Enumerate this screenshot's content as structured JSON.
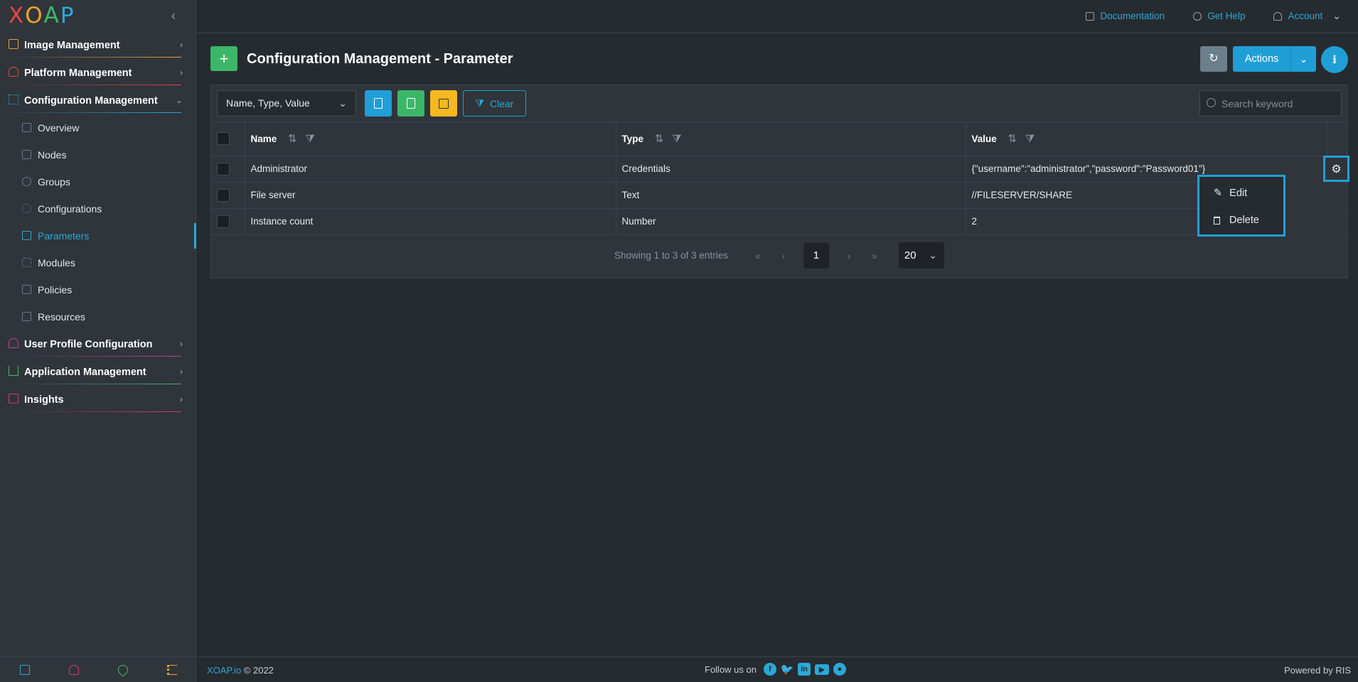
{
  "app": {
    "logo": [
      "X",
      "O",
      "A",
      "P"
    ],
    "logo_colors": [
      "#e8453c",
      "#f0a030",
      "#40b868",
      "#2aa8d8"
    ]
  },
  "topbar": {
    "documentation": "Documentation",
    "get_help": "Get Help",
    "account": "Account"
  },
  "sidebar": {
    "groups": [
      {
        "label": "Image Management",
        "color": "#f0a030",
        "icon": "image-icon"
      },
      {
        "label": "Platform Management",
        "color": "#e8453c",
        "icon": "cloud-icon"
      },
      {
        "label": "Configuration Management",
        "color": "#2aa8d8",
        "icon": "config-icon"
      }
    ],
    "items": [
      {
        "label": "Overview"
      },
      {
        "label": "Nodes"
      },
      {
        "label": "Groups"
      },
      {
        "label": "Configurations"
      },
      {
        "label": "Parameters"
      },
      {
        "label": "Modules"
      },
      {
        "label": "Policies"
      },
      {
        "label": "Resources"
      }
    ],
    "groups2": [
      {
        "label": "User Profile Configuration",
        "color": "#c2409a",
        "icon": "user-profile-icon"
      },
      {
        "label": "Application Management",
        "color": "#40b868",
        "icon": "sitemap-icon"
      },
      {
        "label": "Insights",
        "color": "#d63a6a",
        "icon": "monitor-icon"
      }
    ]
  },
  "header": {
    "add": "+",
    "title": "Configuration Management - Parameter",
    "actions": "Actions",
    "info": "i"
  },
  "toolbar": {
    "columns": "Name, Type, Value",
    "clear": "Clear",
    "search_placeholder": "Search keyword"
  },
  "table": {
    "headers": [
      "Name",
      "Type",
      "Value"
    ],
    "rows": [
      {
        "name": "Administrator",
        "type": "Credentials",
        "value": "{\"username\":\"administrator\",\"password\":\"Password01\"}"
      },
      {
        "name": "File server",
        "type": "Text",
        "value": "//FILESERVER/SHARE"
      },
      {
        "name": "Instance count",
        "type": "Number",
        "value": "2"
      }
    ]
  },
  "pager": {
    "showing": "Showing 1 to 3 of 3 entries",
    "page": "1",
    "per_page": "20"
  },
  "menu": {
    "edit": "Edit",
    "delete": "Delete"
  },
  "footer": {
    "brand": "XOAP.io",
    "copyright": " © 2022",
    "follow": "Follow us on",
    "powered": "Powered by RIS"
  }
}
